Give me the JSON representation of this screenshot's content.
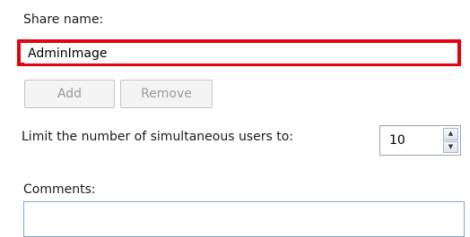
{
  "share_name": {
    "label": "Share name:",
    "value": "AdminImage"
  },
  "buttons": {
    "add_label": "Add",
    "remove_label": "Remove"
  },
  "limit": {
    "label": "Limit the number of simultaneous users to:",
    "value": "10",
    "up_icon": "▲",
    "down_icon": "▼"
  },
  "comments": {
    "label": "Comments:",
    "value": ""
  },
  "colors": {
    "highlight": "#e8000b",
    "focus_border": "#7aa7d6"
  }
}
